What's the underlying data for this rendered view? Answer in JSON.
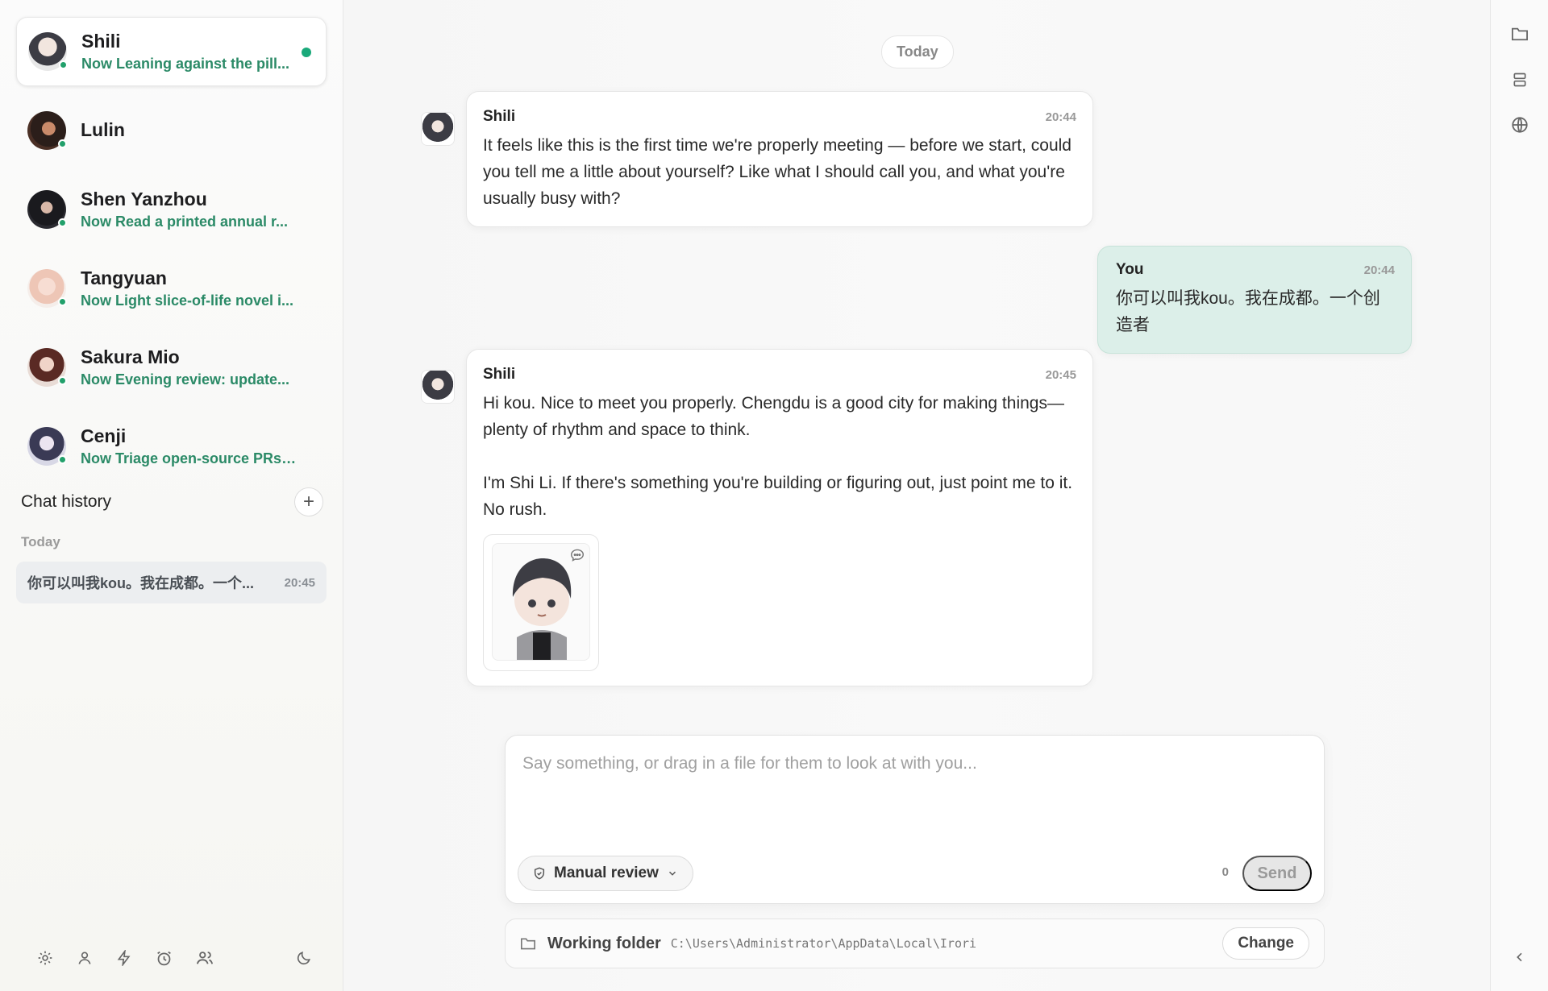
{
  "sidebar": {
    "contacts": [
      {
        "name": "Shili",
        "status": "Now Leaning against the pill...",
        "online": true,
        "unread": true,
        "active": true
      },
      {
        "name": "Lulin",
        "status": "",
        "online": true,
        "unread": false,
        "active": false
      },
      {
        "name": "Shen Yanzhou",
        "status": "Now Read a printed annual r...",
        "online": true,
        "unread": false,
        "active": false
      },
      {
        "name": "Tangyuan",
        "status": "Now Light slice-of-life novel i...",
        "online": true,
        "unread": false,
        "active": false
      },
      {
        "name": "Sakura Mio",
        "status": "Now Evening review: update...",
        "online": true,
        "unread": false,
        "active": false
      },
      {
        "name": "Cenji",
        "status": "Now Triage open-source PRs:...",
        "online": true,
        "unread": false,
        "active": false
      }
    ],
    "history_title": "Chat history",
    "add_label": "+",
    "history_group": "Today",
    "history_items": [
      {
        "text": "你可以叫我kou。我在成都。一个...",
        "time": "20:45"
      }
    ],
    "bottom_icons": [
      "settings-icon",
      "profile-icon",
      "bolt-icon",
      "alarm-icon",
      "group-icon",
      "moon-icon"
    ]
  },
  "chat": {
    "day_label": "Today",
    "messages": [
      {
        "sender": "Shili",
        "time": "20:44",
        "paragraphs": [
          "It feels like this is the first time we're properly meeting — before we start, could you tell me a little about yourself? Like what I should call you, and what you're usually busy with?"
        ]
      },
      {
        "sender": "You",
        "time": "20:44",
        "paragraphs": [
          "你可以叫我kou。我在成都。一个创造者"
        ]
      },
      {
        "sender": "Shili",
        "time": "20:45",
        "paragraphs": [
          "Hi kou. Nice to meet you properly. Chengdu is a good city for making things—plenty of rhythm and space to think.",
          "I'm Shi Li. If there's something you're building or figuring out, just point me to it. No rush."
        ]
      }
    ]
  },
  "composer": {
    "placeholder": "Say something, or drag in a file for them to look at with you...",
    "review_label": "Manual review",
    "count": "0",
    "send_label": "Send"
  },
  "workdir": {
    "label": "Working folder",
    "path": "C:\\Users\\Administrator\\AppData\\Local\\Irori",
    "change_label": "Change"
  },
  "rail": {
    "icons": [
      "folder-icon",
      "layers-icon",
      "globe-icon",
      "chevron-left-icon"
    ]
  },
  "colors": {
    "accent": "#2b8a67",
    "online": "#22a06b",
    "mine_bubble": "#dcefe9"
  }
}
